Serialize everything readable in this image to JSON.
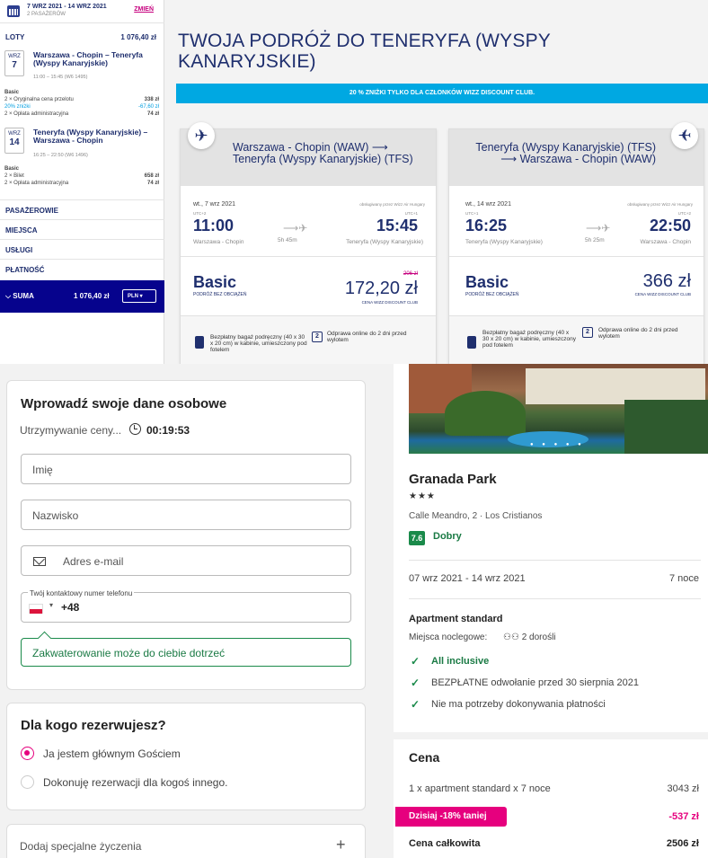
{
  "sidebar": {
    "dates": "7 WRZ 2021 - 14 WRZ 2021",
    "passengers": "2 PASAŻERÓW",
    "change": "ZMIEŃ",
    "flights_label": "LOTY",
    "flights_total": "1 076,40 zł",
    "out": {
      "month": "WRZ",
      "day": "7",
      "route": "Warszawa - Chopin – Teneryfa (Wyspy Kanaryjskie)",
      "time": "11:00 – 15:45 (W6 1495)"
    },
    "out_breakdown": {
      "title": "Basic",
      "rows": [
        {
          "l": "2 × Oryginalna cena przelotu",
          "v": "338 zł"
        },
        {
          "l": "20% zniżki",
          "v": "-67,60 zł"
        },
        {
          "l": "2 × Opłata administracyjna",
          "v": "74 zł"
        }
      ]
    },
    "ret": {
      "month": "WRZ",
      "day": "14",
      "route": "Teneryfa (Wyspy Kanaryjskie) – Warszawa - Chopin",
      "time": "16:25 – 22:50 (W6 1496)"
    },
    "ret_breakdown": {
      "title": "Basic",
      "rows": [
        {
          "l": "2 × Bilet",
          "v": "658 zł"
        },
        {
          "l": "2 × Opłata administracyjna",
          "v": "74 zł"
        }
      ]
    },
    "sections": [
      "PASAŻEROWIE",
      "MIEJSCA",
      "USŁUGI",
      "PŁATNOŚĆ"
    ],
    "sum_label": "SUMA",
    "sum_value": "1 076,40 zł",
    "currency": "PLN"
  },
  "main": {
    "title": "TWOJA PODRÓŻ DO TENERYFA (WYSPY KANARYJSKIE)",
    "promo": "20 % ZNIŻKI TYLKO DLA CZŁONKÓW WIZZ DISCOUNT CLUB."
  },
  "cards": [
    {
      "route": "Warszawa - Chopin (WAW) ⟶ Teneryfa (Wyspy Kanaryjskie) (TFS)",
      "date": "wt., 7 wrz 2021",
      "operated": "obsługiwany przez Wizz Air Hungary",
      "utc_dep": "UTC+2",
      "utc_arr": "UTC+1",
      "dep": "11:00",
      "arr": "15:45",
      "dep_airport": "Warszawa - Chopin",
      "arr_airport": "Teneryfa (Wyspy Kanaryjskie)",
      "duration": "5h 45m",
      "fare": "Basic",
      "fare_sub": "PODRÓŻ BEZ OBCIĄŻEŃ",
      "old_price": "206 zł",
      "price": "172,20 zł",
      "price_sub": "CENA WIZZ DISCOUNT CLUB",
      "bag": "Bezpłatny bagaż podręczny (40 x 30 x 20 cm) w kabinie, umieszczony pod fotelem",
      "checkin": "Odprawa online do 2 dni przed wylotem"
    },
    {
      "route": "Teneryfa (Wyspy Kanaryjskie) (TFS) ⟶ Warszawa - Chopin (WAW)",
      "date": "wt., 14 wrz 2021",
      "operated": "obsługiwany przez Wizz Air Hungary",
      "utc_dep": "UTC+1",
      "utc_arr": "UTC+2",
      "dep": "16:25",
      "arr": "22:50",
      "dep_airport": "Teneryfa (Wyspy Kanaryjskie)",
      "arr_airport": "Warszawa - Chopin",
      "duration": "5h 25m",
      "fare": "Basic",
      "fare_sub": "PODRÓŻ BEZ OBCIĄŻEŃ",
      "price": "366 zł",
      "price_sub": "CENA WIZZ DISCOUNT CLUB",
      "bag": "Bezpłatny bagaż podręczny (40 x 30 x 20 cm) w kabinie, umieszczony pod fotelem",
      "checkin": "Odprawa online do 2 dni przed wylotem"
    }
  ],
  "form": {
    "title": "Wprowadź swoje dane osobowe",
    "hold_label": "Utrzymywanie ceny...",
    "timer": "00:19:53",
    "first_name": "Imię",
    "last_name": "Nazwisko",
    "email": "Adres e-mail",
    "phone_label": "Twój kontaktowy numer telefonu",
    "phone_prefix": "+48",
    "hint": "Zakwaterowanie może do ciebie dotrzeć",
    "who_title": "Dla kogo rezerwujesz?",
    "opt1": "Ja jestem głównym Gościem",
    "opt2": "Dokonuję rezerwacji dla kogoś innego.",
    "special": "Dodaj specjalne życzenia",
    "plus": "+"
  },
  "hotel": {
    "name": "Granada Park",
    "stars": "★★★",
    "address": "Calle Meandro, 2 · Los Cristianos",
    "score": "7.6",
    "rating": "Dobry",
    "dates": "07 wrz 2021 - 14 wrz 2021",
    "nights": "7 noce",
    "room": "Apartment standard",
    "beds_label": "Miejsca noclegowe:",
    "people": "2 dorośli",
    "features": [
      "All inclusive",
      "BEZPŁATNE odwołanie przed 30 sierpnia 2021",
      "Nie ma potrzeby dokonywania płatności"
    ],
    "price_title": "Cena",
    "line_label": "1 x apartment standard x 7 noce",
    "line_value": "3043 zł",
    "discount_label": "Dzisiaj -18% taniej",
    "discount_value": "-537 zł",
    "total_label": "Cena całkowita",
    "total_value": "2506 zł"
  }
}
